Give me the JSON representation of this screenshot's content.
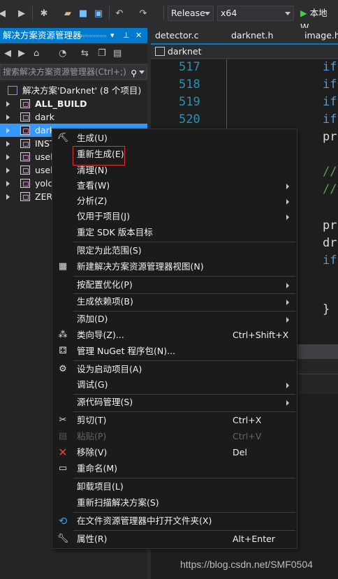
{
  "toolbar": {
    "config": "Release",
    "platform": "x64",
    "run_label": "本地 W"
  },
  "solution_explorer": {
    "title": "解决方案资源管理器",
    "search_placeholder": "搜索解决方案资源管理器(Ctrl+;)",
    "solution": "解决方案'Darknet' (8 个项目)",
    "items": [
      {
        "label": "ALL_BUILD",
        "bold": true
      },
      {
        "label": "dark"
      },
      {
        "label": "dark",
        "selected": true
      },
      {
        "label": "INST"
      },
      {
        "label": "usel"
      },
      {
        "label": "usel"
      },
      {
        "label": "yolc"
      },
      {
        "label": "ZER"
      }
    ]
  },
  "editor": {
    "tabs": [
      "detector.c",
      "darknet.h",
      "image.h"
    ],
    "nav_label": "darknet",
    "line_numbers": [
      "517",
      "518",
      "519",
      "520"
    ],
    "code_lines": [
      {
        "text": "if",
        "kind": "keyword"
      },
      {
        "text": "if",
        "kind": "keyword"
      },
      {
        "text": "if",
        "kind": "keyword"
      },
      {
        "text": "if",
        "kind": "keyword"
      },
      {
        "text": "pr",
        "kind": "plain"
      },
      {
        "text": "//",
        "kind": "comment"
      },
      {
        "text": "//",
        "kind": "comment"
      },
      {
        "text": "pr",
        "kind": "plain"
      },
      {
        "text": "dr",
        "kind": "plain"
      },
      {
        "text": "if",
        "kind": "keyword"
      },
      {
        "text": "}",
        "kind": "plain"
      }
    ]
  },
  "context_menu": {
    "items": [
      {
        "label": "生成(U)",
        "icon": "build-icon"
      },
      {
        "label": "重新生成(E)",
        "highlighted": true
      },
      {
        "label": "清理(N)"
      },
      {
        "label": "查看(W)",
        "submenu": true
      },
      {
        "label": "分析(Z)",
        "submenu": true
      },
      {
        "label": "仅用于项目(J)",
        "submenu": true
      },
      {
        "label": "重定 SDK 版本目标"
      },
      {
        "label": "限定为此范围(S)"
      },
      {
        "label": "新建解决方案资源管理器视图(N)",
        "icon": "new-view-icon"
      },
      {
        "label": "按配置优化(P)",
        "submenu": true
      },
      {
        "label": "生成依赖项(B)",
        "submenu": true
      },
      {
        "label": "添加(D)",
        "submenu": true
      },
      {
        "label": "类向导(Z)...",
        "shortcut": "Ctrl+Shift+X",
        "icon": "class-wizard-icon"
      },
      {
        "label": "管理 NuGet 程序包(N)...",
        "icon": "nuget-icon"
      },
      {
        "label": "设为启动项目(A)",
        "icon": "gear-icon"
      },
      {
        "label": "调试(G)",
        "submenu": true
      },
      {
        "label": "源代码管理(S)",
        "submenu": true
      },
      {
        "label": "剪切(T)",
        "shortcut": "Ctrl+X",
        "icon": "scissors-icon"
      },
      {
        "label": "粘贴(P)",
        "shortcut": "Ctrl+V",
        "icon": "paste-icon",
        "disabled": true
      },
      {
        "label": "移除(V)",
        "shortcut": "Del",
        "icon": "remove-icon"
      },
      {
        "label": "重命名(M)",
        "icon": "rename-icon"
      },
      {
        "label": "卸载项目(L)"
      },
      {
        "label": "重新扫描解决方案(S)"
      },
      {
        "label": "在文件资源管理器中打开文件夹(X)",
        "icon": "refresh-icon"
      },
      {
        "label": "属性(R)",
        "shortcut": "Alt+Enter",
        "icon": "wrench-icon"
      }
    ]
  },
  "watermark": "https://blog.csdn.net/SMF0504"
}
